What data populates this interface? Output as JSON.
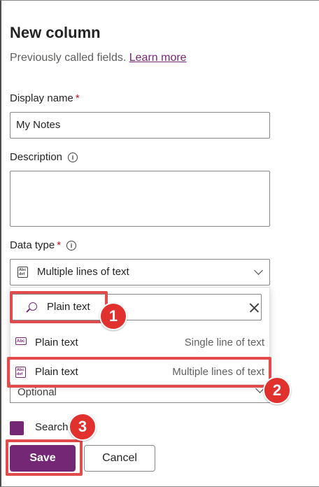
{
  "panel": {
    "title": "New column",
    "subtitle": "Previously called fields.",
    "learn_more": "Learn more"
  },
  "display_name": {
    "label": "Display name",
    "required_mark": "*",
    "value": "My Notes"
  },
  "description": {
    "label": "Description",
    "info_icon": "i",
    "value": ""
  },
  "data_type": {
    "label": "Data type",
    "required_mark": "*",
    "info_icon": "i",
    "selected": "Multiple lines of text",
    "search_query": "Plain text",
    "options": [
      {
        "name": "Plain text",
        "description": "Single line of text",
        "icon": "text-single-line-icon"
      },
      {
        "name": "Plain text",
        "description": "Multiple lines of text",
        "icon": "text-multiline-icon"
      }
    ]
  },
  "required_field": {
    "value": "Optional"
  },
  "searchable": {
    "label": "Search"
  },
  "buttons": {
    "save": "Save",
    "cancel": "Cancel"
  },
  "callouts": [
    "1",
    "2",
    "3"
  ],
  "colors": {
    "accent": "#742774",
    "highlight": "#e14b4b",
    "badge": "#e1312f"
  }
}
